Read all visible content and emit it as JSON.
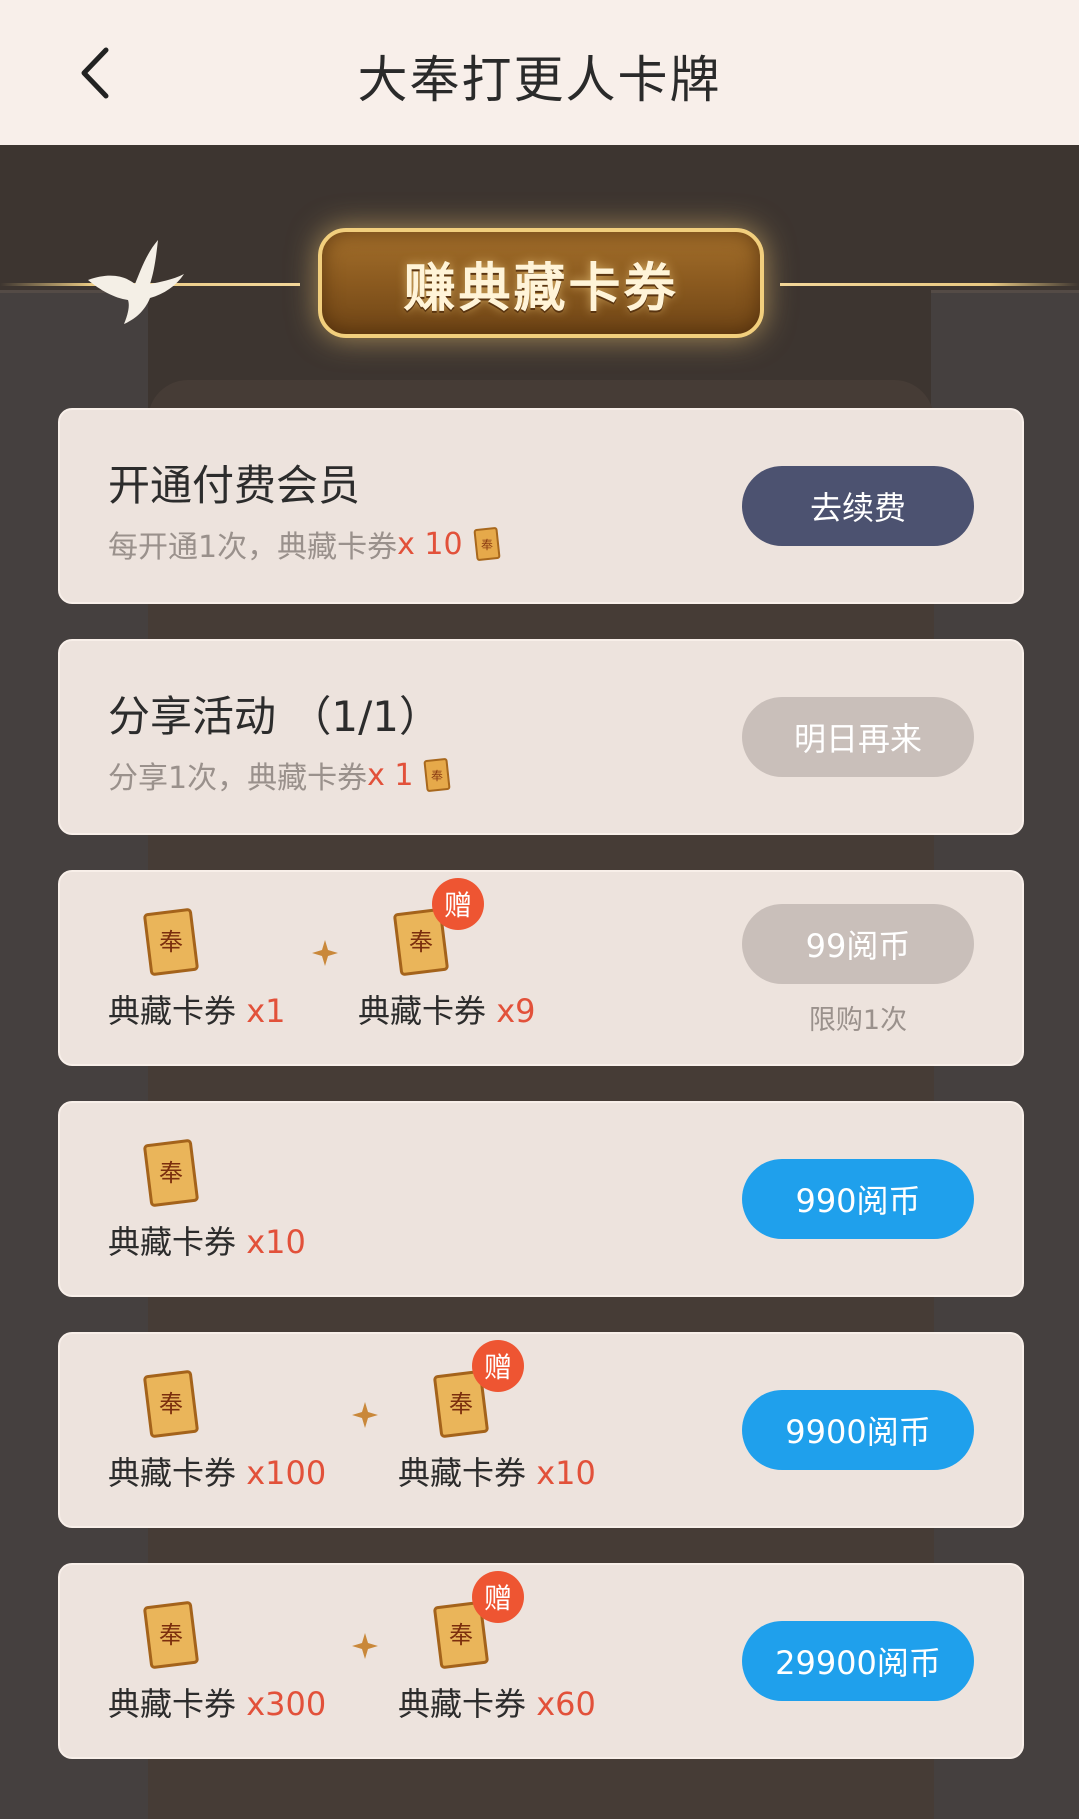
{
  "header": {
    "title": "大奉打更人卡牌",
    "back_icon": "chevron-left-icon"
  },
  "banner": {
    "title": "赚典藏卡券"
  },
  "colors": {
    "red": "#e2513a",
    "blue_button": "#1fa0ec",
    "dark_button": "#4c5270",
    "gray_button": "#c9bfba",
    "gift_badge": "#ee5532"
  },
  "tasks": [
    {
      "title": "开通付费会员",
      "sub": "每开通1次，典藏卡券 ",
      "reward": "x 10",
      "button": "去续费",
      "button_style": "dark"
    },
    {
      "title": "分享活动 （1/1）",
      "sub": "分享1次，典藏卡券 ",
      "reward": "x 1",
      "button": "明日再来",
      "button_style": "gray"
    }
  ],
  "packs": [
    {
      "items": [
        {
          "name": "典藏卡券 ",
          "qty": "x1"
        },
        {
          "name": "典藏卡券 ",
          "qty": "x9",
          "gift": "赠"
        }
      ],
      "button": "99阅币",
      "button_style": "gray",
      "note": "限购1次"
    },
    {
      "items": [
        {
          "name": "典藏卡券 ",
          "qty": "x10"
        }
      ],
      "button": "990阅币",
      "button_style": "blue"
    },
    {
      "items": [
        {
          "name": "典藏卡券 ",
          "qty": "x100"
        },
        {
          "name": "典藏卡券 ",
          "qty": "x10",
          "gift": "赠"
        }
      ],
      "button": "9900阅币",
      "button_style": "blue"
    },
    {
      "items": [
        {
          "name": "典藏卡券 ",
          "qty": "x300"
        },
        {
          "name": "典藏卡券 ",
          "qty": "x60",
          "gift": "赠"
        }
      ],
      "button": "29900阅币",
      "button_style": "blue"
    }
  ]
}
